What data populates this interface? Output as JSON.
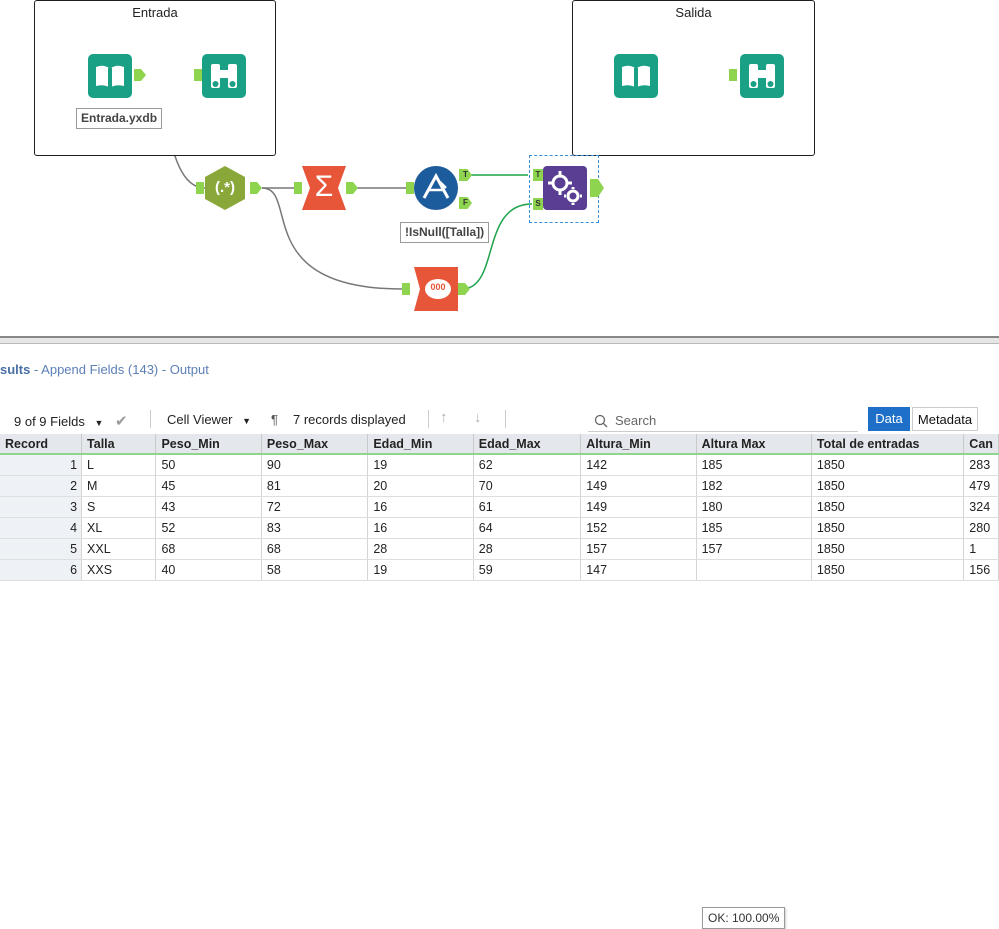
{
  "canvas": {
    "containers": [
      {
        "title": "Entrada"
      },
      {
        "title": "Salida"
      }
    ],
    "annotations": {
      "input_file": "Entrada.yxdb",
      "filter_expression": "!IsNull([Talla])"
    },
    "tools": {
      "input_icon": "book-icon",
      "browse_icon": "binoculars-icon",
      "regex_label": "(.*)",
      "summarize_label": "Σ",
      "filter_true": "T",
      "filter_false": "F",
      "append_target": "T",
      "append_source": "S",
      "sample_label": "000"
    },
    "colors": {
      "teal": "#1aa085",
      "regex": "#8aa83a",
      "summarize": "#e8563a",
      "filter": "#1d5c9c",
      "append": "#5a3e94",
      "connector_green": "#1ea34a",
      "connector_gray": "#777777"
    }
  },
  "results": {
    "title": "sults",
    "subtitle": " - Append Fields (143) - Output",
    "toolbar": {
      "fields": "9 of 9 Fields",
      "cell_viewer": "Cell Viewer",
      "pilcrow": "¶",
      "records": "7 records displayed",
      "search_placeholder": "Search",
      "tab_data": "Data",
      "tab_metadata": "Metadata"
    },
    "columns": [
      "Record",
      "Talla",
      "Peso_Min",
      "Peso_Max",
      "Edad_Min",
      "Edad_Max",
      "Altura_Min",
      "Altura Max",
      "Total de entradas",
      "Can"
    ],
    "rows": [
      [
        "1",
        "L",
        "50",
        "90",
        "19",
        "62",
        "142",
        "185",
        "1850",
        "283"
      ],
      [
        "2",
        "M",
        "45",
        "81",
        "20",
        "70",
        "149",
        "182",
        "1850",
        "479"
      ],
      [
        "3",
        "S",
        "43",
        "72",
        "16",
        "61",
        "149",
        "180",
        "1850",
        "324"
      ],
      [
        "4",
        "XL",
        "52",
        "83",
        "16",
        "64",
        "152",
        "185",
        "1850",
        "280"
      ],
      [
        "5",
        "XXL",
        "68",
        "68",
        "28",
        "28",
        "157",
        "157",
        "1850",
        "1"
      ],
      [
        "6",
        "XXS",
        "40",
        "58",
        "19",
        "59",
        "147",
        "",
        "1850",
        "156"
      ]
    ],
    "tooltip": "OK: 100.00%"
  }
}
